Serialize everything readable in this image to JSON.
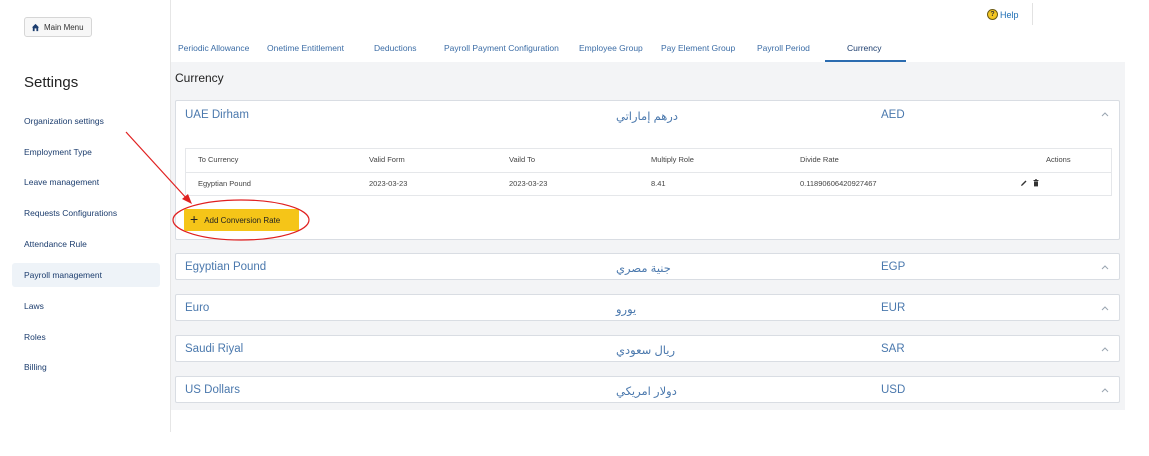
{
  "sidebar": {
    "main_menu_label": "Main Menu",
    "settings_title": "Settings",
    "items": [
      {
        "label": "Organization settings"
      },
      {
        "label": "Employment Type"
      },
      {
        "label": "Leave management"
      },
      {
        "label": "Requests Configurations"
      },
      {
        "label": "Attendance Rule"
      },
      {
        "label": "Payroll management"
      },
      {
        "label": "Laws"
      },
      {
        "label": "Roles"
      },
      {
        "label": "Billing"
      }
    ],
    "active_item": "Payroll management"
  },
  "header": {
    "help_label": "Help"
  },
  "tabs": [
    {
      "label": "Periodic Allowance"
    },
    {
      "label": "Onetime Entitlement"
    },
    {
      "label": "Deductions"
    },
    {
      "label": "Payroll Payment Configuration"
    },
    {
      "label": "Employee Group"
    },
    {
      "label": "Pay Element Group"
    },
    {
      "label": "Payroll Period"
    },
    {
      "label": "Currency"
    }
  ],
  "active_tab": "Currency",
  "content": {
    "title": "Currency",
    "currencies": [
      {
        "name": "UAE Dirham",
        "arabic": "درهم إماراتي",
        "code": "AED",
        "expanded": true
      },
      {
        "name": "Egyptian Pound",
        "arabic": "جنية مصري",
        "code": "EGP",
        "expanded": false
      },
      {
        "name": "Euro",
        "arabic": "يورو",
        "code": "EUR",
        "expanded": false
      },
      {
        "name": "Saudi Riyal",
        "arabic": "ريال سعودي",
        "code": "SAR",
        "expanded": false
      },
      {
        "name": "US Dollars",
        "arabic": "دولار امريكي",
        "code": "USD",
        "expanded": false
      }
    ],
    "table": {
      "headers": [
        "To Currency",
        "Valid Form",
        "Vaild To",
        "Multiply Role",
        "Divide Rate",
        "Actions"
      ],
      "rows": [
        {
          "to_currency": "Egyptian Pound",
          "valid_from": "2023-03-23",
          "valid_to": "2023-03-23",
          "multiply": "8.41",
          "divide": "0.11890606420927467"
        }
      ]
    },
    "add_button_label": "Add Conversion Rate"
  },
  "colors": {
    "accent_yellow": "#f5c518",
    "link_blue": "#4a78ad",
    "annotation_red": "#e02020"
  }
}
